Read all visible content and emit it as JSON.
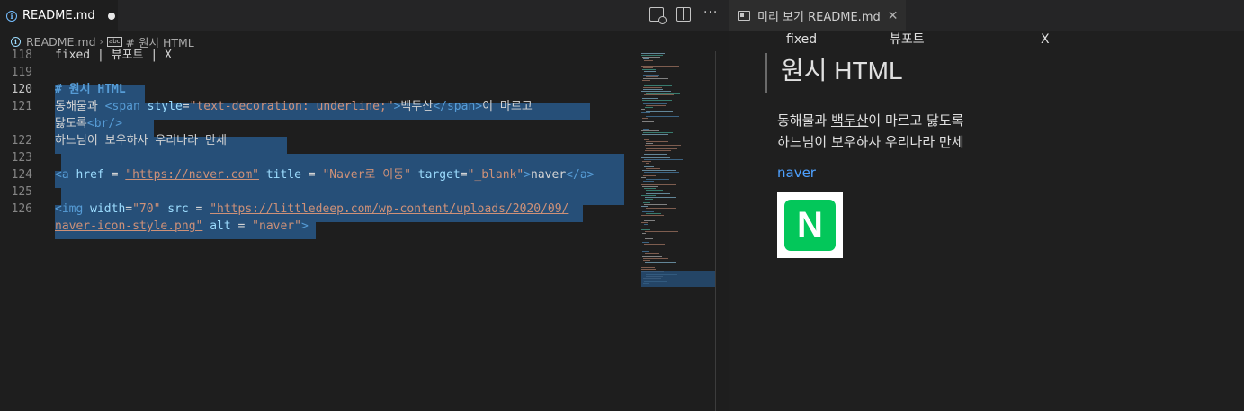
{
  "editor": {
    "tab_title": "README.md",
    "breadcrumb": {
      "file": "README.md",
      "symbol": "# 원시 HTML"
    },
    "lines": [
      {
        "num": "118",
        "text": "fixed | 뷰포트 | X"
      },
      {
        "num": "119",
        "text": ""
      },
      {
        "num": "120",
        "text": "# 원시 HTML"
      },
      {
        "num": "121",
        "text": "동해물과 <span style=\"text-decoration: underline;\">백두산</span>이 마르고 닳도록<br/>"
      },
      {
        "num": "122",
        "text": "하느님이 보우하사 우리나라 만세"
      },
      {
        "num": "123",
        "text": ""
      },
      {
        "num": "124",
        "text": "<a href = \"https://naver.com\" title = \"Naver로 이동\" target=\"_blank\">naver</a>"
      },
      {
        "num": "125",
        "text": ""
      },
      {
        "num": "126",
        "text": "<img width=\"70\" src = \"https://littledeep.com/wp-content/uploads/2020/09/naver-icon-style.png\" alt = \"naver\">"
      }
    ],
    "code": {
      "l118": "fixed | 뷰포트 | X",
      "l120_hash": "#",
      "l120_text": "원시 HTML",
      "l121_a": "동해물과 ",
      "l121_tag1": "<span ",
      "l121_attr": "style",
      "l121_eq": "=",
      "l121_str": "\"text-decoration: underline;\"",
      "l121_close": ">",
      "l121_word": "백두산",
      "l121_tag2": "</span>",
      "l121_b": "이 마르고",
      "l121w_a": "닳도록",
      "l121w_tag": "<br/>",
      "l122": "하느님이 보우하사 우리나라 만세",
      "l124_open": "<a ",
      "l124_href": "href",
      "l124_eq1": " = ",
      "l124_url": "\"https://naver.com\"",
      "l124_title": " title",
      "l124_eq2": " = ",
      "l124_titlev": "\"Naver로 이동\"",
      "l124_target": " target",
      "l124_eq3": "=",
      "l124_targetv": "\"_blank\"",
      "l124_gt": ">",
      "l124_text": "naver",
      "l124_closea": "</a>",
      "l126_open": "<img ",
      "l126_width": "width",
      "l126_eq1": "=",
      "l126_widthv": "\"70\"",
      "l126_src": " src",
      "l126_eq2": " = ",
      "l126_srcv": "\"https://littledeep.com/wp-content/uploads/2020/09/",
      "l126w_srcv": "naver-icon-style.png\"",
      "l126w_alt": " alt",
      "l126w_eq": " = ",
      "l126w_altv": "\"naver\"",
      "l126w_gt": ">"
    }
  },
  "preview": {
    "tab_title": "미리 보기 README.md",
    "table_row": [
      "fixed",
      "뷰포트",
      "X"
    ],
    "heading": "원시 HTML",
    "para_line1_a": "동해물과 ",
    "para_line1_u": "백두산",
    "para_line1_b": "이 마르고 닳도록",
    "para_line2": "하느님이 보우하사 우리나라 만세",
    "link_text": "naver",
    "image_logo_letter": "N"
  },
  "colors": {
    "selection": "#264f78",
    "link": "#4ea1ff",
    "naver_green": "#03c75a"
  }
}
